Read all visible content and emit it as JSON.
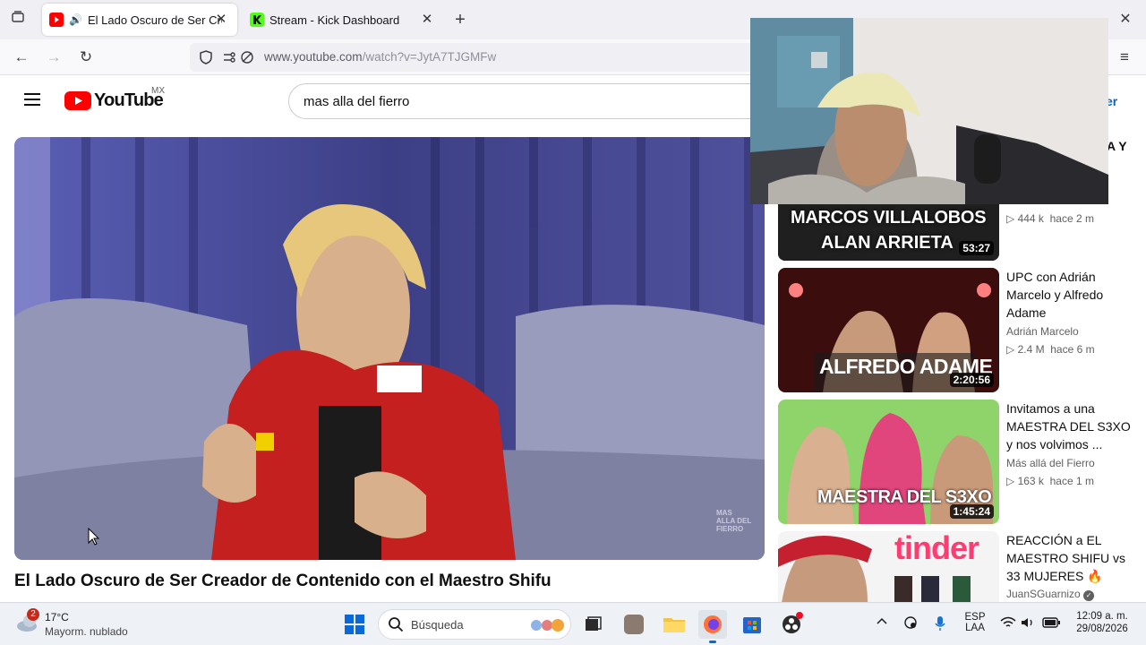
{
  "browser": {
    "tabs": [
      {
        "title": "El Lado Oscuro de Ser Crea",
        "active": true
      },
      {
        "title": "Stream - Kick Dashboard",
        "active": false
      }
    ],
    "url_host": "www.youtube.com",
    "url_path": "/watch?v=JytA7TJGMFw"
  },
  "youtube": {
    "logo_text": "YouTube",
    "region": "MX",
    "search_query": "mas alla del fierro",
    "signin_partial": "er",
    "partial_rec_title": "A Y"
  },
  "video": {
    "title": "El Lado Oscuro de Ser Creador de Contenido con el Maestro Shifu",
    "watermark": "MAS ALLA DEL FIERRO"
  },
  "recommendations": [
    {
      "thumb_text_1": "MARCOS VILLALOBOS",
      "thumb_text_2": "ALAN ARRIETA",
      "duration": "53:27",
      "views": "444 k",
      "age": "hace 2 m"
    },
    {
      "title": "UPC con Adrián Marcelo y Alfredo Adame",
      "thumb_text": "ALFREDO ADAME",
      "duration": "2:20:56",
      "channel": "Adrián Marcelo",
      "views": "2.4 M",
      "age": "hace 6 m"
    },
    {
      "title": "Invitamos a una MAESTRA DEL S3XO y nos volvimos ...",
      "thumb_text": "MAESTRA DEL S3XO",
      "duration": "1:45:24",
      "channel": "Más allá del Fierro",
      "views": "163 k",
      "age": "hace 1 m"
    },
    {
      "title": "REACCIÓN a EL MAESTRO SHIFU vs 33 MUJERES 🔥",
      "thumb_text": "tinder",
      "channel": "JuanSGuarnizo"
    }
  ],
  "taskbar": {
    "weather_badge": "2",
    "temperature": "17°C",
    "condition": "Mayorm. nublado",
    "search_label": "Búsqueda",
    "lang_1": "ESP",
    "lang_2": "LAA",
    "time": "12:09 a. m.",
    "date": "29/08/2026"
  },
  "colors": {
    "youtube_red": "#ff0000",
    "kick_green": "#53fc18",
    "firefox_orange": "#ff7139"
  }
}
